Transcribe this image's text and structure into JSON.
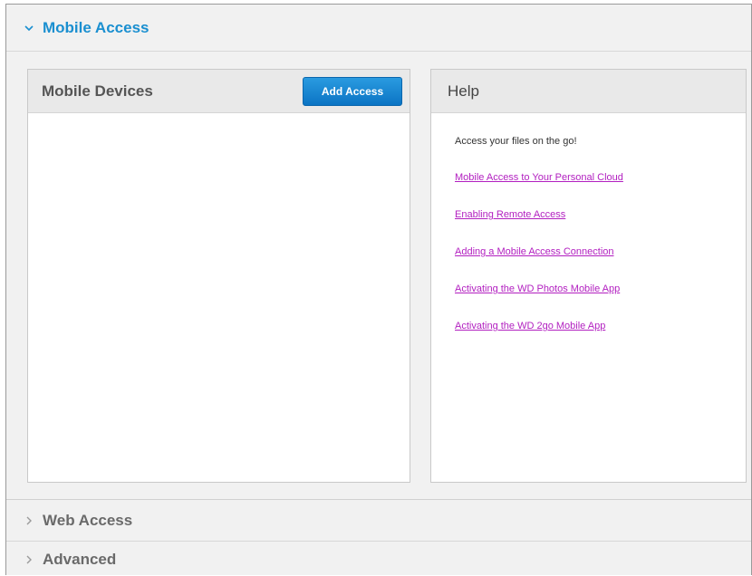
{
  "sections": {
    "mobile_access": {
      "title": "Mobile Access",
      "expanded": true
    },
    "web_access": {
      "title": "Web Access",
      "expanded": false
    },
    "advanced": {
      "title": "Advanced",
      "expanded": false
    }
  },
  "devices_panel": {
    "title": "Mobile Devices",
    "add_button_label": "Add Access"
  },
  "help_panel": {
    "title": "Help",
    "intro": "Access your files on the go!",
    "links": [
      "Mobile Access to Your Personal Cloud",
      "Enabling Remote Access",
      "Adding a Mobile Access Connection",
      "Activating the WD Photos Mobile App",
      "Activating the WD 2go Mobile App"
    ]
  },
  "icons": {
    "expanded_chevron": "chevron-down-icon",
    "collapsed_chevron": "chevron-right-icon"
  },
  "colors": {
    "accent_blue": "#1a8fd0",
    "button_blue": "#0b74c4",
    "link_purple": "#b21fc0",
    "collapsed_title": "#6a6a6a"
  }
}
